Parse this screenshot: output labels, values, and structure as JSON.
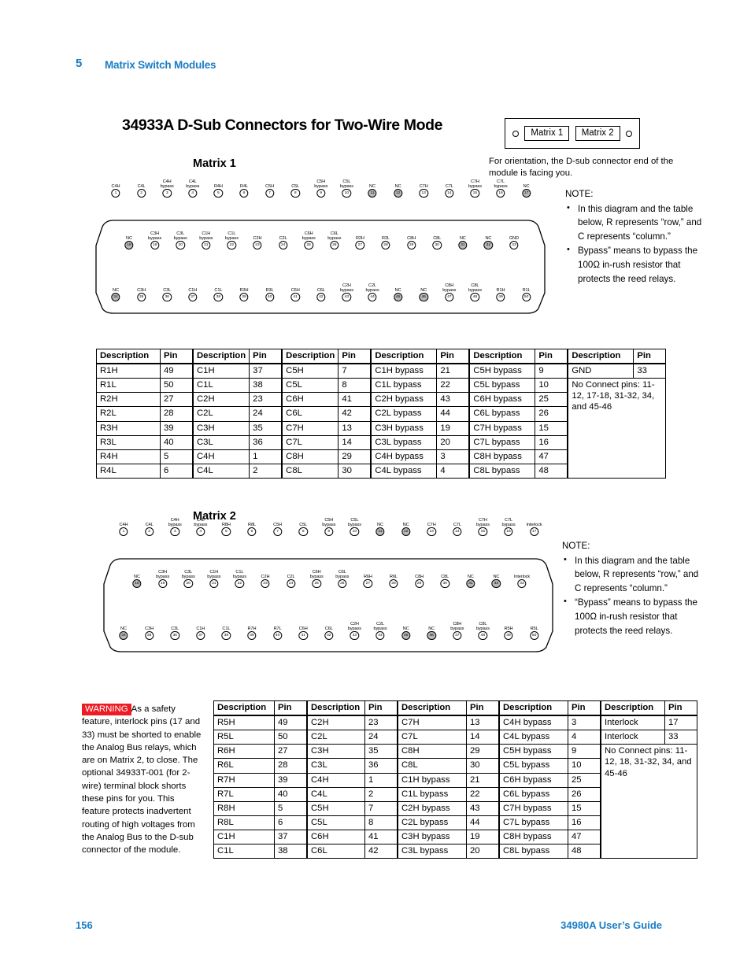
{
  "header": {
    "chapter_number": "5",
    "chapter_title": "Matrix Switch Modules"
  },
  "page_title": "34933A D-Sub Connectors for Two-Wire Mode",
  "matrix1_heading": "Matrix 1",
  "matrix2_heading": "Matrix 2",
  "orientation": {
    "chip1": "Matrix 1",
    "chip2": "Matrix 2",
    "caption": "For orientation, the D-sub connector end of the module is facing you."
  },
  "note1": {
    "title": "NOTE:",
    "bullets": [
      "In this diagram and the table below, R represents “row,” and C represents “column.”",
      "Bypass” means to bypass the 100Ω in-rush resistor that protects the reed relays."
    ]
  },
  "note2": {
    "title": "NOTE:",
    "bullets": [
      "In this diagram and the table below, R represents “row,” and C represents “column.”",
      "“Bypass” means to bypass the 100Ω in-rush resistor that protects the reed relays."
    ]
  },
  "connector1": {
    "row1": [
      {
        "pin": "1",
        "label": "C4H",
        "nc": false
      },
      {
        "pin": "2",
        "label": "C4L",
        "nc": false
      },
      {
        "pin": "3",
        "label": "C4H bypass",
        "nc": false
      },
      {
        "pin": "4",
        "label": "C4L bypass",
        "nc": false
      },
      {
        "pin": "5",
        "label": "R4H",
        "nc": false
      },
      {
        "pin": "6",
        "label": "R4L",
        "nc": false
      },
      {
        "pin": "7",
        "label": "C5H",
        "nc": false
      },
      {
        "pin": "8",
        "label": "C5L",
        "nc": false
      },
      {
        "pin": "9",
        "label": "C5H bypass",
        "nc": false
      },
      {
        "pin": "10",
        "label": "C5L bypass",
        "nc": false
      },
      {
        "pin": "11",
        "label": "NC",
        "nc": true
      },
      {
        "pin": "12",
        "label": "NC",
        "nc": true
      },
      {
        "pin": "13",
        "label": "C7H",
        "nc": false
      },
      {
        "pin": "14",
        "label": "C7L",
        "nc": false
      },
      {
        "pin": "15",
        "label": "C7H bypass",
        "nc": false
      },
      {
        "pin": "16",
        "label": "C7L bypass",
        "nc": false
      },
      {
        "pin": "17",
        "label": "NC",
        "nc": true
      }
    ],
    "row2": [
      {
        "pin": "18",
        "label": "NC",
        "nc": true
      },
      {
        "pin": "19",
        "label": "C3H bypass",
        "nc": false
      },
      {
        "pin": "20",
        "label": "C3L bypass",
        "nc": false
      },
      {
        "pin": "21",
        "label": "C1H bypass",
        "nc": false
      },
      {
        "pin": "22",
        "label": "C1L bypass",
        "nc": false
      },
      {
        "pin": "23",
        "label": "C2H",
        "nc": false
      },
      {
        "pin": "24",
        "label": "C2L",
        "nc": false
      },
      {
        "pin": "25",
        "label": "C6H bypass",
        "nc": false
      },
      {
        "pin": "26",
        "label": "C6L bypass",
        "nc": false
      },
      {
        "pin": "27",
        "label": "R2H",
        "nc": false
      },
      {
        "pin": "28",
        "label": "R2L",
        "nc": false
      },
      {
        "pin": "29",
        "label": "C8H",
        "nc": false
      },
      {
        "pin": "30",
        "label": "C8L",
        "nc": false
      },
      {
        "pin": "31",
        "label": "NC",
        "nc": true
      },
      {
        "pin": "32",
        "label": "NC",
        "nc": true
      },
      {
        "pin": "33",
        "label": "GND",
        "nc": false
      }
    ],
    "row3": [
      {
        "pin": "34",
        "label": "NC",
        "nc": true
      },
      {
        "pin": "35",
        "label": "C3H",
        "nc": false
      },
      {
        "pin": "36",
        "label": "C3L",
        "nc": false
      },
      {
        "pin": "37",
        "label": "C1H",
        "nc": false
      },
      {
        "pin": "38",
        "label": "C1L",
        "nc": false
      },
      {
        "pin": "39",
        "label": "R3H",
        "nc": false
      },
      {
        "pin": "40",
        "label": "R3L",
        "nc": false
      },
      {
        "pin": "41",
        "label": "C6H",
        "nc": false
      },
      {
        "pin": "42",
        "label": "C6L",
        "nc": false
      },
      {
        "pin": "43",
        "label": "C2H bypass",
        "nc": false
      },
      {
        "pin": "44",
        "label": "C2L bypass",
        "nc": false
      },
      {
        "pin": "45",
        "label": "NC",
        "nc": true
      },
      {
        "pin": "46",
        "label": "NC",
        "nc": true
      },
      {
        "pin": "47",
        "label": "C8H bypass",
        "nc": false
      },
      {
        "pin": "48",
        "label": "C8L bypass",
        "nc": false
      },
      {
        "pin": "49",
        "label": "R1H",
        "nc": false
      },
      {
        "pin": "50",
        "label": "R1L",
        "nc": false
      }
    ]
  },
  "connector2": {
    "row1": [
      {
        "pin": "1",
        "label": "C4H",
        "nc": false
      },
      {
        "pin": "2",
        "label": "C4L",
        "nc": false
      },
      {
        "pin": "3",
        "label": "C4H bypass",
        "nc": false
      },
      {
        "pin": "4",
        "label": "C4L bypass",
        "nc": false
      },
      {
        "pin": "5",
        "label": "R8H",
        "nc": false
      },
      {
        "pin": "6",
        "label": "R8L",
        "nc": false
      },
      {
        "pin": "7",
        "label": "C5H",
        "nc": false
      },
      {
        "pin": "8",
        "label": "C5L",
        "nc": false
      },
      {
        "pin": "9",
        "label": "C5H bypass",
        "nc": false
      },
      {
        "pin": "10",
        "label": "C5L bypass",
        "nc": false
      },
      {
        "pin": "11",
        "label": "NC",
        "nc": true
      },
      {
        "pin": "12",
        "label": "NC",
        "nc": true
      },
      {
        "pin": "13",
        "label": "C7H",
        "nc": false
      },
      {
        "pin": "14",
        "label": "C7L",
        "nc": false
      },
      {
        "pin": "15",
        "label": "C7H bypass",
        "nc": false
      },
      {
        "pin": "16",
        "label": "C7L bypass",
        "nc": false
      },
      {
        "pin": "17",
        "label": "Interlock",
        "nc": false
      }
    ],
    "row2": [
      {
        "pin": "18",
        "label": "NC",
        "nc": true
      },
      {
        "pin": "19",
        "label": "C3H bypass",
        "nc": false
      },
      {
        "pin": "20",
        "label": "C3L bypass",
        "nc": false
      },
      {
        "pin": "21",
        "label": "C1H bypass",
        "nc": false
      },
      {
        "pin": "22",
        "label": "C1L bypass",
        "nc": false
      },
      {
        "pin": "23",
        "label": "C2H",
        "nc": false
      },
      {
        "pin": "24",
        "label": "C2L",
        "nc": false
      },
      {
        "pin": "25",
        "label": "C6H bypass",
        "nc": false
      },
      {
        "pin": "26",
        "label": "C6L bypass",
        "nc": false
      },
      {
        "pin": "27",
        "label": "R6H",
        "nc": false
      },
      {
        "pin": "28",
        "label": "R6L",
        "nc": false
      },
      {
        "pin": "29",
        "label": "C8H",
        "nc": false
      },
      {
        "pin": "30",
        "label": "C8L",
        "nc": false
      },
      {
        "pin": "31",
        "label": "NC",
        "nc": true
      },
      {
        "pin": "32",
        "label": "NC",
        "nc": true
      },
      {
        "pin": "33",
        "label": "Interlock",
        "nc": false
      }
    ],
    "row3": [
      {
        "pin": "34",
        "label": "NC",
        "nc": true
      },
      {
        "pin": "35",
        "label": "C3H",
        "nc": false
      },
      {
        "pin": "36",
        "label": "C3L",
        "nc": false
      },
      {
        "pin": "37",
        "label": "C1H",
        "nc": false
      },
      {
        "pin": "38",
        "label": "C1L",
        "nc": false
      },
      {
        "pin": "39",
        "label": "R7H",
        "nc": false
      },
      {
        "pin": "40",
        "label": "R7L",
        "nc": false
      },
      {
        "pin": "41",
        "label": "C6H",
        "nc": false
      },
      {
        "pin": "42",
        "label": "C6L",
        "nc": false
      },
      {
        "pin": "43",
        "label": "C2H bypass",
        "nc": false
      },
      {
        "pin": "44",
        "label": "C2L bypass",
        "nc": false
      },
      {
        "pin": "45",
        "label": "NC",
        "nc": true
      },
      {
        "pin": "46",
        "label": "NC",
        "nc": true
      },
      {
        "pin": "47",
        "label": "C8H bypass",
        "nc": false
      },
      {
        "pin": "48",
        "label": "C8L bypass",
        "nc": false
      },
      {
        "pin": "49",
        "label": "R5H",
        "nc": false
      },
      {
        "pin": "50",
        "label": "R5L",
        "nc": false
      }
    ]
  },
  "table1": {
    "headers": [
      "Description",
      "Pin"
    ],
    "groups": [
      {
        "rows": [
          [
            "R1H",
            "49"
          ],
          [
            "R1L",
            "50"
          ],
          [
            "R2H",
            "27"
          ],
          [
            "R2L",
            "28"
          ],
          [
            "R3H",
            "39"
          ],
          [
            "R3L",
            "40"
          ],
          [
            "R4H",
            "5"
          ],
          [
            "R4L",
            "6"
          ]
        ]
      },
      {
        "rows": [
          [
            "C1H",
            "37"
          ],
          [
            "C1L",
            "38"
          ],
          [
            "C2H",
            "23"
          ],
          [
            "C2L",
            "24"
          ],
          [
            "C3H",
            "35"
          ],
          [
            "C3L",
            "36"
          ],
          [
            "C4H",
            "1"
          ],
          [
            "C4L",
            "2"
          ]
        ]
      },
      {
        "rows": [
          [
            "C5H",
            "7"
          ],
          [
            "C5L",
            "8"
          ],
          [
            "C6H",
            "41"
          ],
          [
            "C6L",
            "42"
          ],
          [
            "C7H",
            "13"
          ],
          [
            "C7L",
            "14"
          ],
          [
            "C8H",
            "29"
          ],
          [
            "C8L",
            "30"
          ]
        ]
      },
      {
        "rows": [
          [
            "C1H bypass",
            "21"
          ],
          [
            "C1L bypass",
            "22"
          ],
          [
            "C2H bypass",
            "43"
          ],
          [
            "C2L bypass",
            "44"
          ],
          [
            "C3H bypass",
            "19"
          ],
          [
            "C3L bypass",
            "20"
          ],
          [
            "C4H bypass",
            "3"
          ],
          [
            "C4L bypass",
            "4"
          ]
        ]
      },
      {
        "rows": [
          [
            "C5H bypass",
            "9"
          ],
          [
            "C5L bypass",
            "10"
          ],
          [
            "C6H bypass",
            "25"
          ],
          [
            "C6L bypass",
            "26"
          ],
          [
            "C7H bypass",
            "15"
          ],
          [
            "C7L bypass",
            "16"
          ],
          [
            "C8H bypass",
            "47"
          ],
          [
            "C8L bypass",
            "48"
          ]
        ]
      },
      {
        "rows": [
          [
            "GND",
            "33"
          ]
        ],
        "no_connect": "No Connect pins: 11-12, 17-18, 31-32, 34, and 45-46"
      }
    ]
  },
  "table2": {
    "headers": [
      "Description",
      "Pin"
    ],
    "groups": [
      {
        "rows": [
          [
            "R5H",
            "49"
          ],
          [
            "R5L",
            "50"
          ],
          [
            "R6H",
            "27"
          ],
          [
            "R6L",
            "28"
          ],
          [
            "R7H",
            "39"
          ],
          [
            "R7L",
            "40"
          ],
          [
            "R8H",
            "5"
          ],
          [
            "R8L",
            "6"
          ],
          [
            "C1H",
            "37"
          ],
          [
            "C1L",
            "38"
          ]
        ]
      },
      {
        "rows": [
          [
            "C2H",
            "23"
          ],
          [
            "C2L",
            "24"
          ],
          [
            "C3H",
            "35"
          ],
          [
            "C3L",
            "36"
          ],
          [
            "C4H",
            "1"
          ],
          [
            "C4L",
            "2"
          ],
          [
            "C5H",
            "7"
          ],
          [
            "C5L",
            "8"
          ],
          [
            "C6H",
            "41"
          ],
          [
            "C6L",
            "42"
          ]
        ]
      },
      {
        "rows": [
          [
            "C7H",
            "13"
          ],
          [
            "C7L",
            "14"
          ],
          [
            "C8H",
            "29"
          ],
          [
            "C8L",
            "30"
          ],
          [
            "C1H bypass",
            "21"
          ],
          [
            "C1L bypass",
            "22"
          ],
          [
            "C2H bypass",
            "43"
          ],
          [
            "C2L bypass",
            "44"
          ],
          [
            "C3H bypass",
            "19"
          ],
          [
            "C3L bypass",
            "20"
          ]
        ]
      },
      {
        "rows": [
          [
            "C4H bypass",
            "3"
          ],
          [
            "C4L bypass",
            "4"
          ],
          [
            "C5H bypass",
            "9"
          ],
          [
            "C5L bypass",
            "10"
          ],
          [
            "C6H bypass",
            "25"
          ],
          [
            "C6L bypass",
            "26"
          ],
          [
            "C7H bypass",
            "15"
          ],
          [
            "C7L bypass",
            "16"
          ],
          [
            "C8H bypass",
            "47"
          ],
          [
            "C8L bypass",
            "48"
          ]
        ]
      },
      {
        "rows": [
          [
            "Interlock",
            "17"
          ],
          [
            "Interlock",
            "33"
          ]
        ],
        "no_connect": "No Connect pins: 11-12, 18, 31-32, 34, and 45-46"
      }
    ]
  },
  "warning": {
    "tag": "WARNING",
    "text": "As a safety feature, interlock pins (17 and 33) must be shorted to enable the Analog Bus relays, which are on Matrix 2, to close. The optional 34933T-001 (for 2-wire) terminal block shorts these pins for you. This feature protects inadvertent routing of high voltages from the Analog Bus to the D-sub connector of the module."
  },
  "footer": {
    "page_number": "156",
    "guide_name": "34980A User’s Guide"
  },
  "colors": {
    "accent_blue": "#1a7cc4",
    "warning_red": "#ed1c24",
    "nc_gray": "#b8b8b8"
  }
}
